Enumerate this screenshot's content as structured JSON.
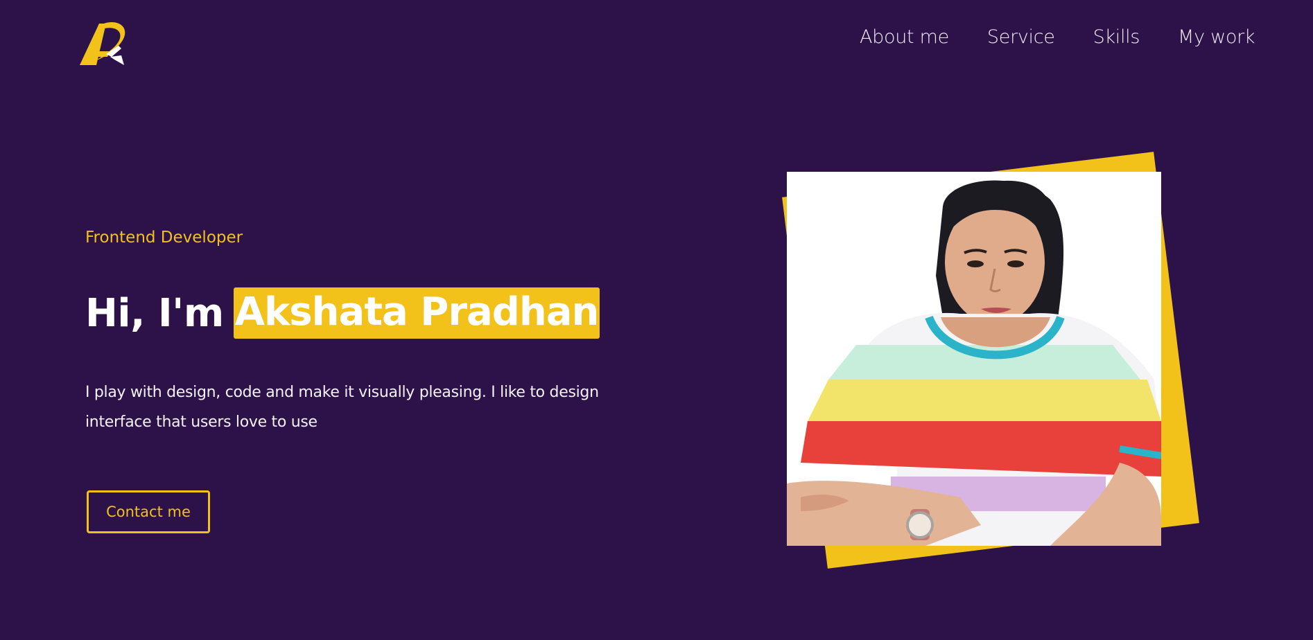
{
  "brand": {
    "logo_icon": "ak-monogram-logo",
    "accent_color": "#f2c21b",
    "background_color": "#2c1249"
  },
  "nav": {
    "items": [
      {
        "label": "About me"
      },
      {
        "label": "Service"
      },
      {
        "label": "Skills"
      },
      {
        "label": "My work"
      }
    ]
  },
  "hero": {
    "role": "Frontend Developer",
    "greeting": "Hi, I'm",
    "name": "Akshata Pradhan",
    "bio": "I play with design, code and make it visually pleasing. I like to design interface that users love to use",
    "cta_label": "Contact me",
    "photo_icon": "profile-photo"
  }
}
